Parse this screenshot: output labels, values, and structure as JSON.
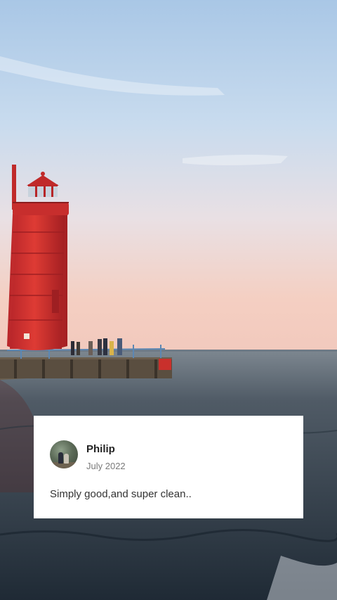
{
  "review": {
    "author": "Philip",
    "date": "July 2022",
    "text": "Simply good,and super clean.."
  }
}
